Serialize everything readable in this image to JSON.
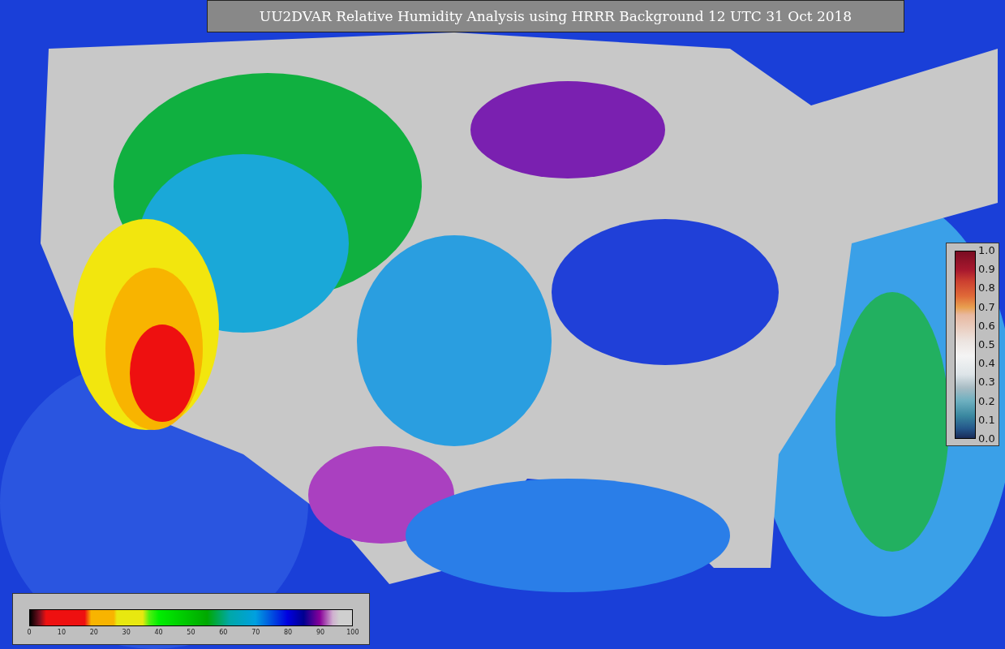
{
  "title": "UU2DVAR Relative Humidity Analysis using HRRR Background 12 UTC 31 Oct 2018",
  "ratio_colorbar": {
    "ticks": [
      "1.0",
      "0.9",
      "0.8",
      "0.7",
      "0.6",
      "0.5",
      "0.4",
      "0.3",
      "0.2",
      "0.1",
      "0.0"
    ]
  },
  "humidity_colorbar": {
    "ticks": [
      "0",
      "10",
      "20",
      "30",
      "40",
      "50",
      "60",
      "70",
      "80",
      "90",
      "100"
    ]
  }
}
